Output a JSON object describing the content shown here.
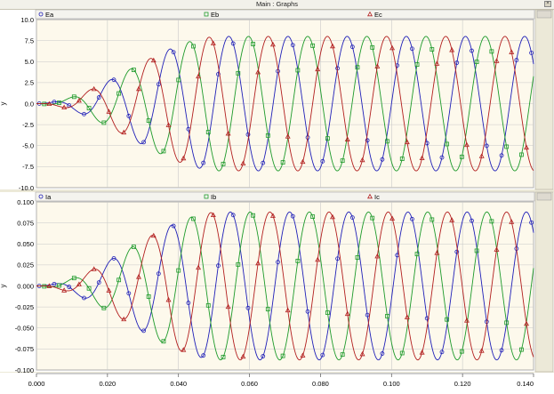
{
  "window": {
    "title": "Main : Graphs"
  },
  "chart_data": [
    {
      "type": "line",
      "ylabel": "y",
      "xlim": [
        0,
        0.14
      ],
      "ylim": [
        -10,
        10
      ],
      "yticks": [
        10.0,
        7.5,
        5.0,
        2.5,
        0.0,
        -2.5,
        -5.0,
        -7.5,
        -10.0
      ],
      "ytick_labels": [
        "10.0",
        "7.5",
        "5.0",
        "2.5",
        "0.0",
        "-2.5",
        "-5.0",
        "-7.5",
        "-10.0"
      ],
      "grid": true,
      "legend": "top",
      "series": [
        {
          "name": "Ea",
          "color": "#1f1fb8",
          "marker": "circle",
          "amplitude": 8.0,
          "phase_deg": 0
        },
        {
          "name": "Eb",
          "color": "#1d9a2a",
          "marker": "square",
          "amplitude": 8.0,
          "phase_deg": -120
        },
        {
          "name": "Ec",
          "color": "#b21e1e",
          "marker": "triangle",
          "amplitude": 8.0,
          "phase_deg": 120
        }
      ],
      "frequency_hz": 60,
      "ramp_end_s": 0.052
    },
    {
      "type": "line",
      "ylabel": "y",
      "xlabel": "",
      "xlim": [
        0,
        0.14
      ],
      "ylim": [
        -0.1,
        0.1
      ],
      "xticks": [
        0.0,
        0.02,
        0.04,
        0.06,
        0.08,
        0.1,
        0.12,
        0.14
      ],
      "xtick_labels": [
        "0.000",
        "0.020",
        "0.040",
        "0.060",
        "0.080",
        "0.100",
        "0.120",
        "0.140"
      ],
      "yticks": [
        0.1,
        0.075,
        0.05,
        0.025,
        0.0,
        -0.025,
        -0.05,
        -0.075,
        -0.1
      ],
      "ytick_labels": [
        "0.100",
        "0.075",
        "0.050",
        "0.025",
        "0.000",
        "-0.025",
        "-0.050",
        "-0.075",
        "-0.100"
      ],
      "grid": true,
      "legend": "top",
      "series": [
        {
          "name": "Ia",
          "color": "#1f1fb8",
          "marker": "circle",
          "amplitude": 0.088,
          "phase_deg": -10
        },
        {
          "name": "Ib",
          "color": "#1d9a2a",
          "marker": "square",
          "amplitude": 0.088,
          "phase_deg": -130
        },
        {
          "name": "Ic",
          "color": "#b21e1e",
          "marker": "triangle",
          "amplitude": 0.088,
          "phase_deg": 110
        }
      ],
      "frequency_hz": 60,
      "ramp_end_s": 0.052
    }
  ],
  "colors": {
    "plot_bg": "#fdf9ec",
    "grid": "#c8c8c8",
    "frame": "#7a7a7a"
  }
}
